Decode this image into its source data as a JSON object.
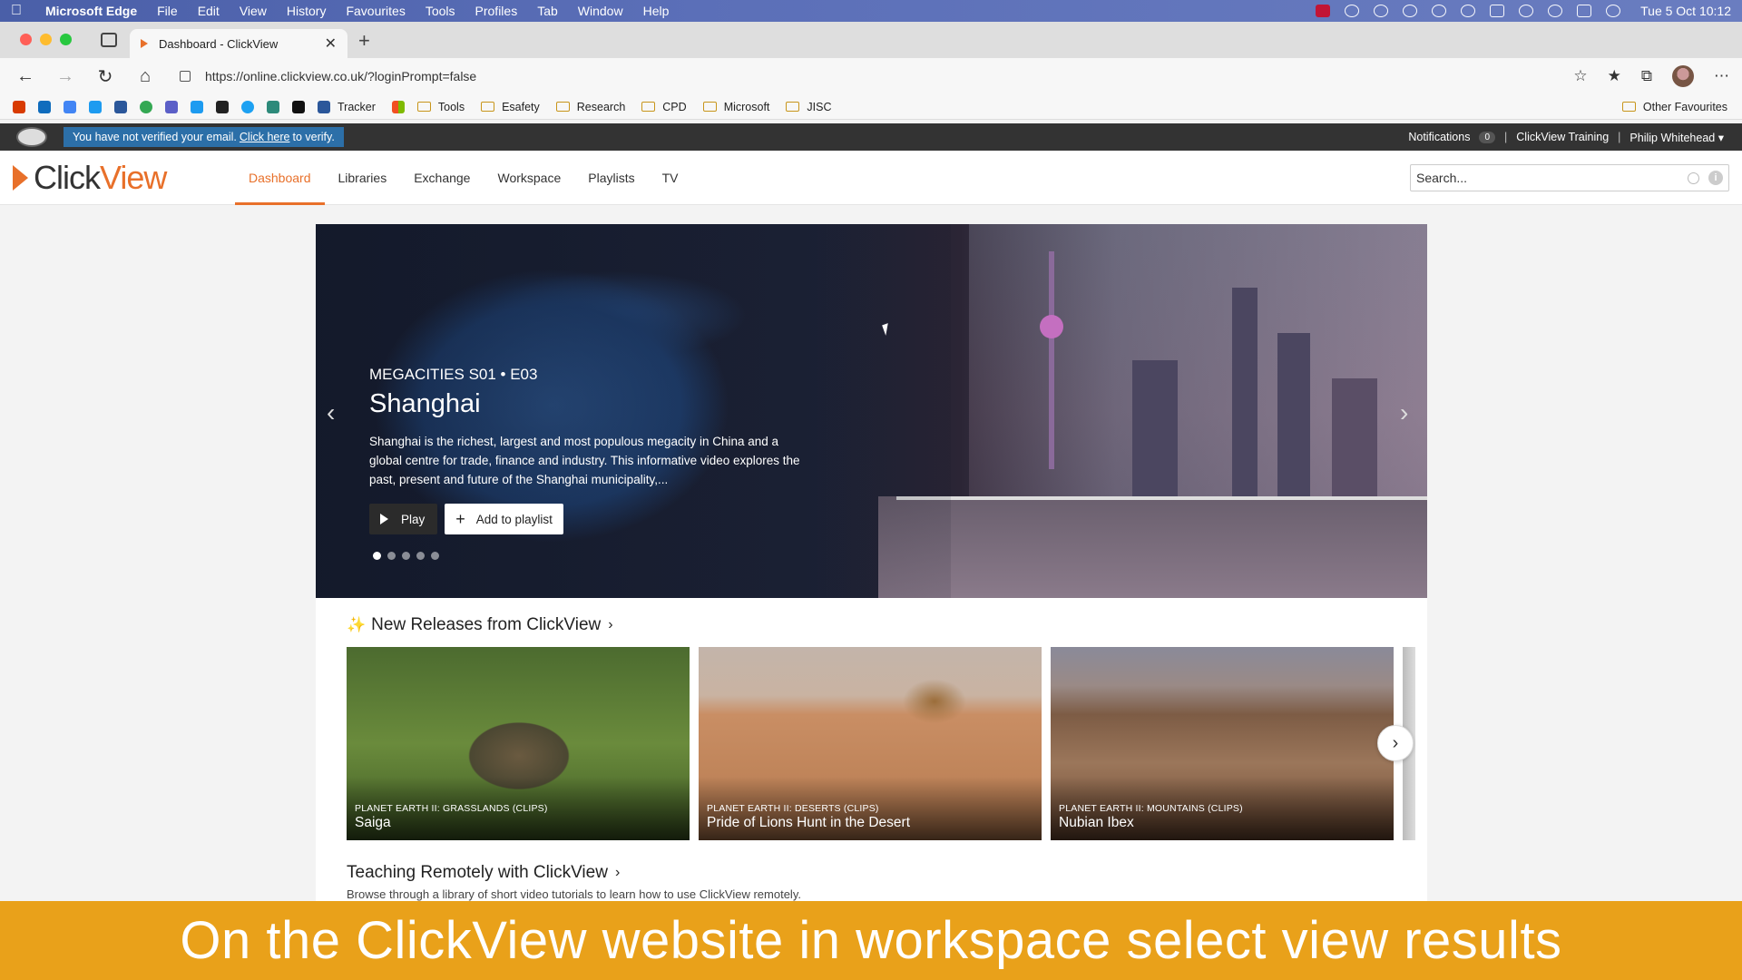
{
  "menubar": {
    "app_name": "Microsoft Edge",
    "items": [
      "File",
      "Edit",
      "View",
      "History",
      "Favourites",
      "Tools",
      "Profiles",
      "Tab",
      "Window",
      "Help"
    ],
    "clock": "Tue 5 Oct  10:12"
  },
  "browser": {
    "tab_title": "Dashboard - ClickView",
    "url": "https://online.clickview.co.uk/?loginPrompt=false",
    "bookmarks": [
      "Tracker",
      "Tools",
      "Esafety",
      "Research",
      "CPD",
      "Microsoft",
      "JISC"
    ],
    "other_favourites": "Other Favourites"
  },
  "cv_strip": {
    "verify_prefix": "You have not verified your email.",
    "verify_link": "Click here",
    "verify_suffix": "to verify.",
    "notifications_label": "Notifications",
    "notifications_count": "0",
    "training_label": "ClickView Training",
    "user_name": "Philip Whitehead"
  },
  "header": {
    "logo_part1": "Click",
    "logo_part2": "View",
    "nav": [
      "Dashboard",
      "Libraries",
      "Exchange",
      "Workspace",
      "Playlists",
      "TV"
    ],
    "search_placeholder": "Search..."
  },
  "hero": {
    "episode": "MEGACITIES S01 • E03",
    "title": "Shanghai",
    "description": "Shanghai is the richest, largest and most populous megacity in China and a global centre for trade, finance and industry. This informative video explores the past, present and future of the Shanghai municipality,...",
    "play_label": "Play",
    "add_label": "Add to playlist"
  },
  "new_releases": {
    "title": "New Releases from ClickView",
    "cards": [
      {
        "series": "PLANET EARTH II: GRASSLANDS (CLIPS)",
        "title": "Saiga"
      },
      {
        "series": "PLANET EARTH II: DESERTS (CLIPS)",
        "title": "Pride of Lions Hunt in the Desert"
      },
      {
        "series": "PLANET EARTH II: MOUNTAINS (CLIPS)",
        "title": "Nubian Ibex"
      }
    ]
  },
  "teaching": {
    "title": "Teaching Remotely with ClickView",
    "subtitle": "Browse through a library of short video tutorials to learn how to use ClickView remotely."
  },
  "caption": "On the ClickView website in workspace select view results",
  "colors": {
    "accent": "#e8702a",
    "caption_bg": "#e9a11a",
    "verify_bg": "#2c6fa8"
  }
}
